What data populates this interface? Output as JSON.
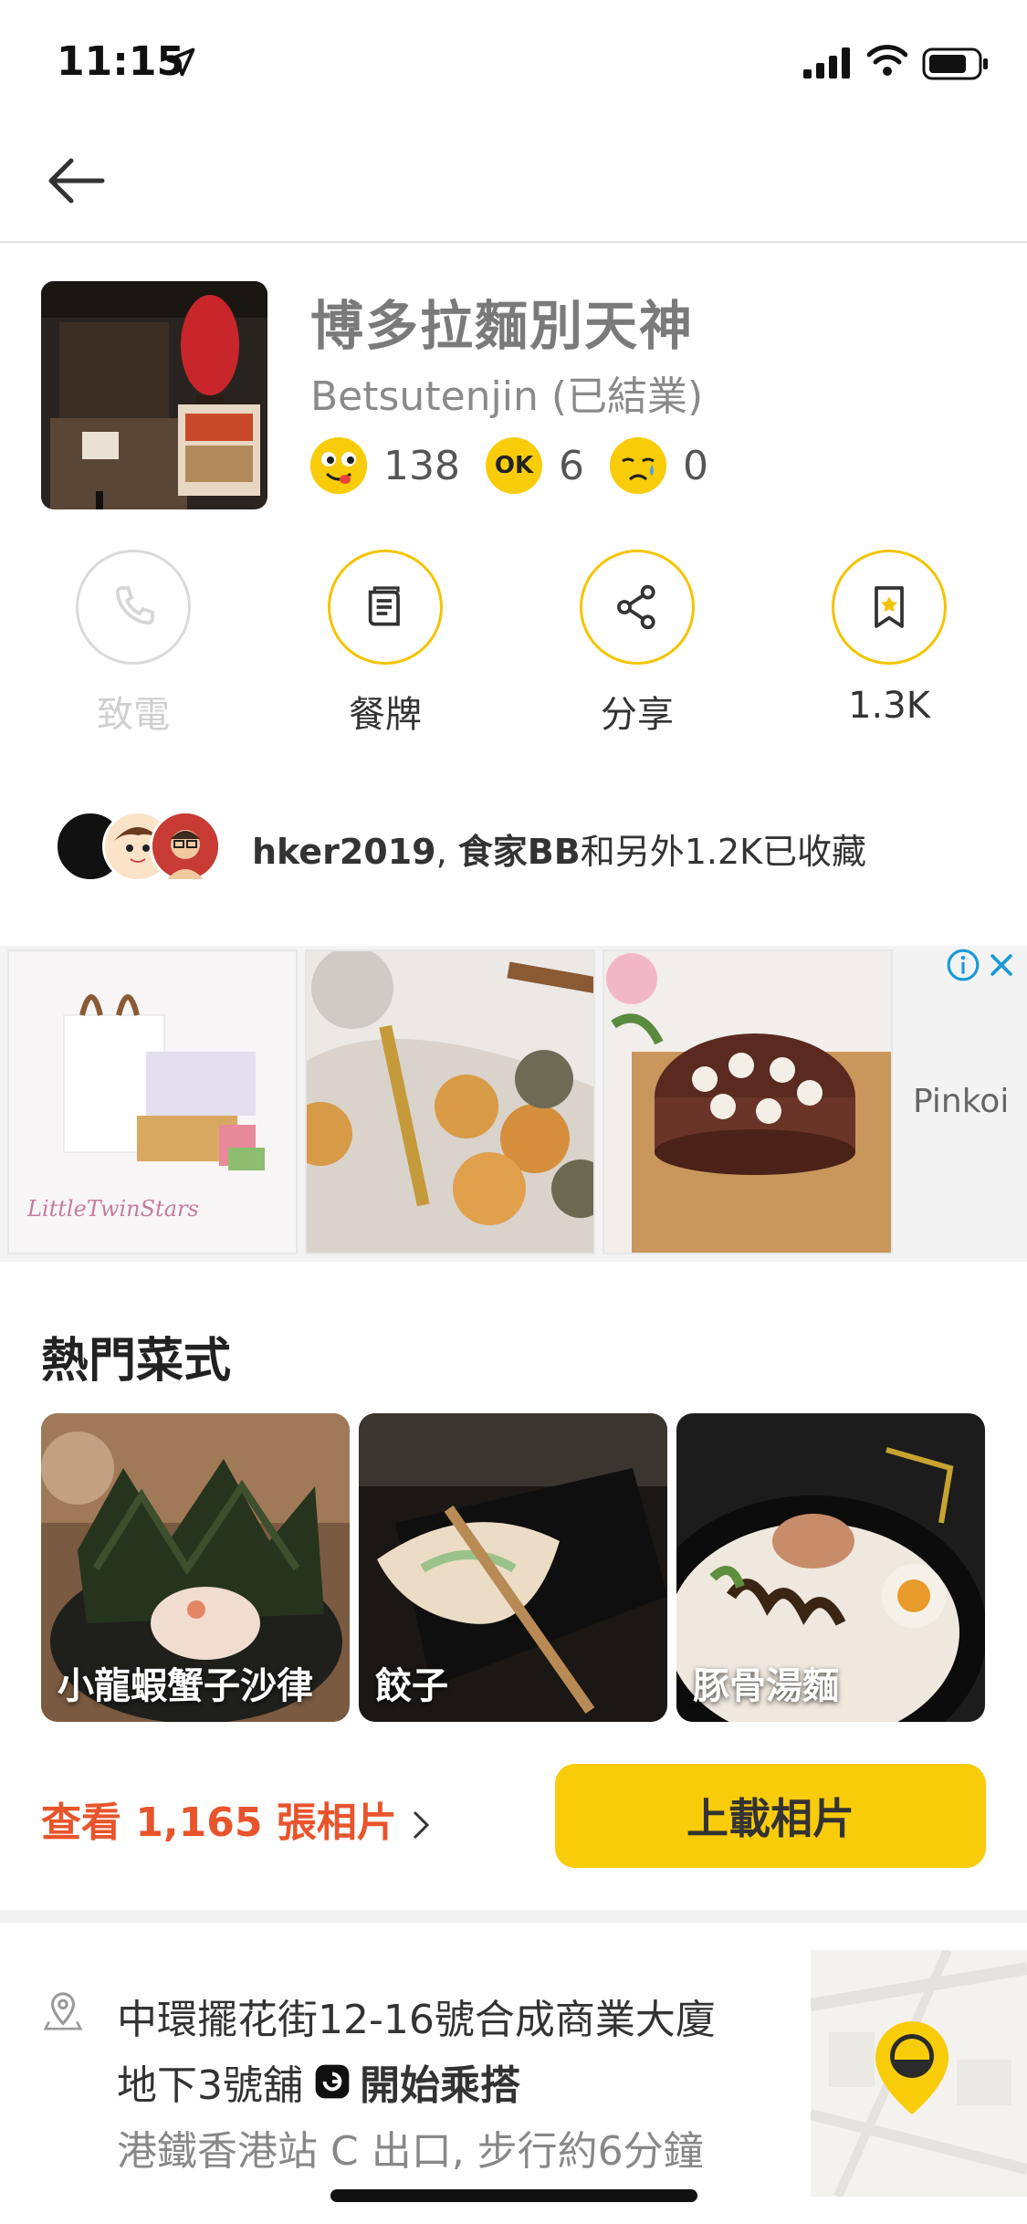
{
  "status_bar": {
    "time": "11:15"
  },
  "restaurant": {
    "name": "博多拉麵別天神",
    "subtitle": "Betsutenjin (已結業)",
    "ratings": {
      "good": "138",
      "ok": "6",
      "bad": "0"
    }
  },
  "actions": {
    "call": "致電",
    "menu": "餐牌",
    "share": "分享",
    "bookmark": "1.3K"
  },
  "bookmarked_by": {
    "user1": "hker2019",
    "sep": ", ",
    "user2": "食家BB",
    "rest": "和另外1.2K已收藏"
  },
  "ad": {
    "brand": "Pinkoi"
  },
  "popular_dishes": {
    "title": "熱門菜式",
    "items": [
      {
        "name": "小龍蝦蟹子沙律"
      },
      {
        "name": "餃子"
      },
      {
        "name": "豚骨湯麵"
      }
    ]
  },
  "photos": {
    "view_label": "查看 1,165 張相片",
    "upload_label": "上載相片"
  },
  "address": {
    "line1": "中環擺花街12-16號合成商業大廈",
    "line2": "地下3號舖",
    "ride": "開始乘搭",
    "line3": "港鐵香港站 C 出口, 步行約6分鐘"
  },
  "colors": {
    "accent": "#f9cc0a",
    "link": "#e8542b"
  }
}
